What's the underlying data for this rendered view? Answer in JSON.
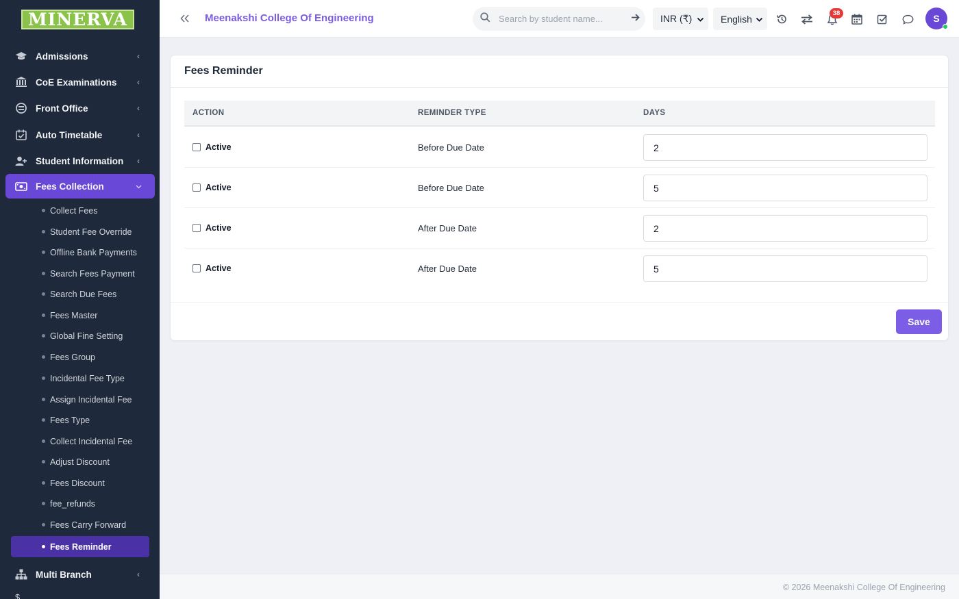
{
  "logo": {
    "text": "MINERVA"
  },
  "sidebar": {
    "menu": [
      {
        "label": "Admissions",
        "icon": "graduation-cap-icon"
      },
      {
        "label": "CoE Examinations",
        "icon": "institution-icon"
      },
      {
        "label": "Front Office",
        "icon": "front-office-icon"
      },
      {
        "label": "Auto Timetable",
        "icon": "calendar-check-icon"
      },
      {
        "label": "Student Information",
        "icon": "user-plus-icon"
      },
      {
        "label": "Fees Collection",
        "icon": "money-icon",
        "active": true
      },
      {
        "label": "Multi Branch",
        "icon": "sitemap-icon"
      }
    ],
    "fees_submenu": [
      "Collect Fees",
      "Student Fee Override",
      "Offline Bank Payments",
      "Search Fees Payment",
      "Search Due Fees",
      "Fees Master",
      "Global Fine Setting",
      "Fees Group",
      "Incidental Fee Type",
      "Assign Incidental Fee",
      "Fees Type",
      "Collect Incidental Fee",
      "Adjust Discount",
      "Fees Discount",
      "fee_refunds",
      "Fees Carry Forward",
      "Fees Reminder"
    ],
    "current_submenu": "Fees Reminder"
  },
  "topbar": {
    "college_name": "Meenakshi College Of Engineering",
    "search_placeholder": "Search by student name...",
    "currency": "INR (₹)",
    "language": "English",
    "notification_count": "38",
    "avatar_initial": "S"
  },
  "card": {
    "title": "Fees Reminder",
    "columns": [
      "ACTION",
      "REMINDER TYPE",
      "DAYS"
    ],
    "rows": [
      {
        "active_label": "Active",
        "checked": false,
        "reminder_type": "Before Due Date",
        "days": "2"
      },
      {
        "active_label": "Active",
        "checked": false,
        "reminder_type": "Before Due Date",
        "days": "5"
      },
      {
        "active_label": "Active",
        "checked": false,
        "reminder_type": "After Due Date",
        "days": "2"
      },
      {
        "active_label": "Active",
        "checked": false,
        "reminder_type": "After Due Date",
        "days": "5"
      }
    ],
    "save_label": "Save"
  },
  "footer": {
    "text": "© 2026 Meenakshi College Of Engineering"
  },
  "colors": {
    "sidebar_bg": "#1e2a3b",
    "accent": "#6a48d7",
    "brand_text": "#7b5ce0",
    "logo_green": "#8bc34a"
  }
}
